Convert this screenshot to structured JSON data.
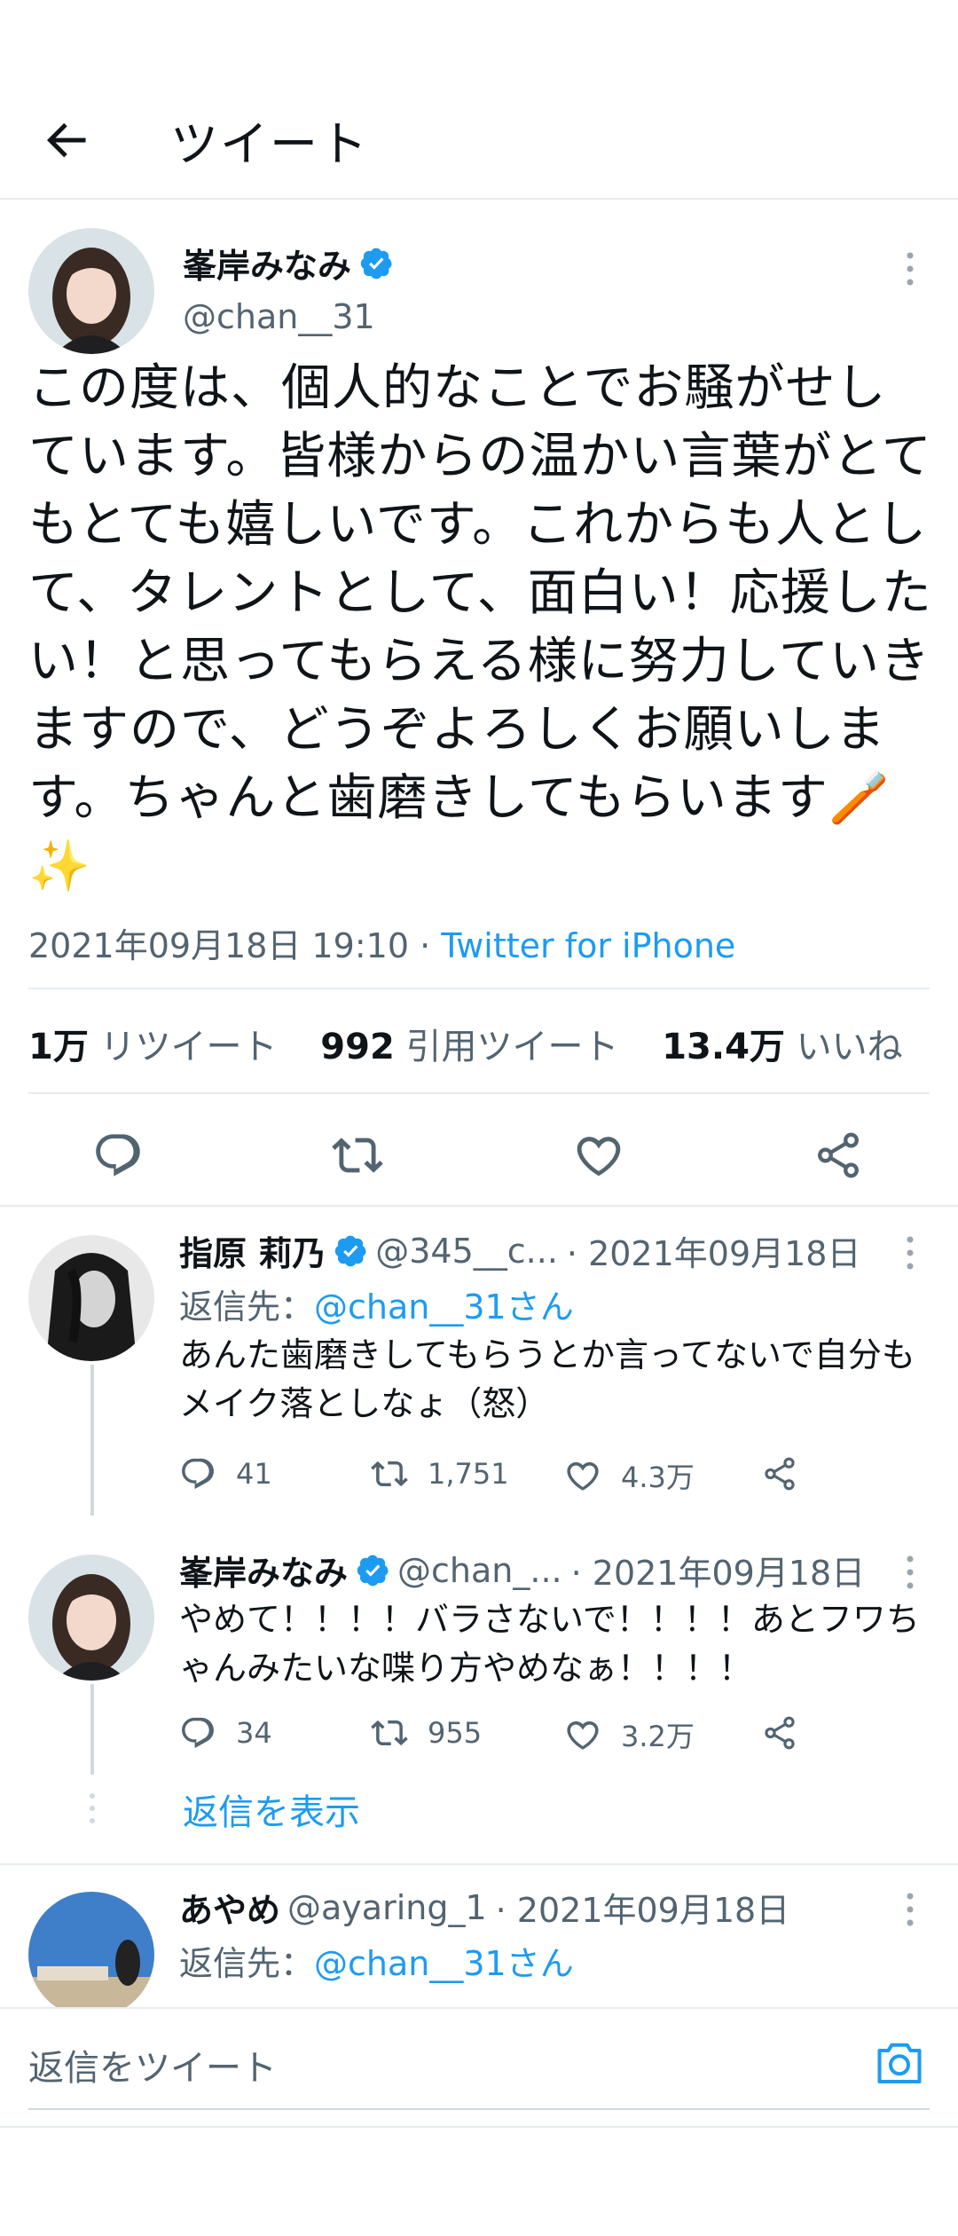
{
  "header": {
    "title": "ツイート"
  },
  "main_tweet": {
    "name": "峯岸みなみ",
    "handle": "@chan__31",
    "text": "この度は、個人的なことでお騒がせしています。皆様からの温かい言葉がとてもとても嬉しいです。これからも人として、タレントとして、面白い！応援したい！と思ってもらえる様に努力していきますので、どうぞよろしくお願いします。ちゃんと歯磨きしてもらいます🪥✨",
    "datetime": "2021年09月18日 19:10",
    "separator": " · ",
    "source": "Twitter for iPhone",
    "stats": {
      "retweets_count": "1万",
      "retweets_label": "リツイート",
      "quotes_count": "992",
      "quotes_label": "引用ツイート",
      "likes_count": "13.4万",
      "likes_label": "いいね"
    }
  },
  "replies": [
    {
      "name": "指原 莉乃",
      "handle": "@345__c...",
      "date": "· 2021年09月18日",
      "reply_to_prefix": "返信先：",
      "reply_to_mention": "@chan__31さん",
      "text": "あんた歯磨きしてもらうとか言ってないで自分もメイク落としなょ（怒）",
      "replies": "41",
      "retweets": "1,751",
      "likes": "4.3万"
    },
    {
      "name": "峯岸みなみ",
      "handle": "@chan_...",
      "date": "· 2021年09月18日",
      "text": "やめて！！！！バラさないで！！！！あとフワちゃんみたいな喋り方やめなぁ！！！！",
      "replies": "34",
      "retweets": "955",
      "likes": "3.2万",
      "show_replies": "返信を表示"
    },
    {
      "name": "あやめ",
      "handle": "@ayaring_1",
      "date": "· 2021年09月18日",
      "reply_to_prefix": "返信先：",
      "reply_to_mention": "@chan__31さん"
    }
  ],
  "compose": {
    "placeholder": "返信をツイート"
  },
  "colors": {
    "accent": "#1d9bf0",
    "text": "#0f1419",
    "secondary": "#536471",
    "divider": "#e6ecf0"
  },
  "icons": [
    "back-arrow-icon",
    "verified-badge-icon",
    "more-icon",
    "reply-icon",
    "retweet-icon",
    "like-icon",
    "share-icon",
    "camera-icon"
  ]
}
